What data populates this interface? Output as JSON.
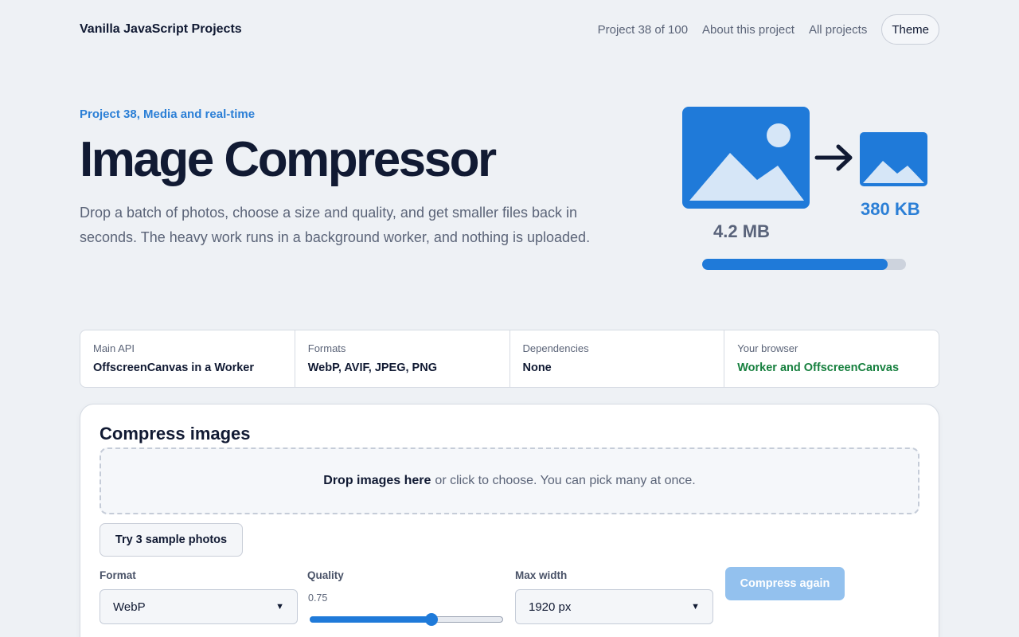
{
  "nav": {
    "brand": "Vanilla JavaScript Projects",
    "project_counter": "Project 38 of 100",
    "about_link": "About this project",
    "all_projects_link": "All projects",
    "theme_button": "Theme"
  },
  "hero": {
    "eyebrow": "Project 38, Media and real-time",
    "title": "Image Compressor",
    "lead": "Drop a batch of photos, choose a size and quality, and get smaller files back in seconds. The heavy work runs in a background worker, and nothing is uploaded.",
    "size_before": "4.2 MB",
    "size_after": "380 KB",
    "progress_fraction": 0.91
  },
  "facts": [
    {
      "label": "Main API",
      "value": "OffscreenCanvas in a Worker"
    },
    {
      "label": "Formats",
      "value": "WebP, AVIF, JPEG, PNG"
    },
    {
      "label": "Dependencies",
      "value": "None"
    },
    {
      "label": "Your browser",
      "value": "Worker and OffscreenCanvas"
    }
  ],
  "compress": {
    "title": "Compress images",
    "dropzone_strong": "Drop images here",
    "dropzone_text": "or click to choose. You can pick many at once.",
    "sample_button": "Try 3 sample photos",
    "format_label": "Format",
    "format_value": "WebP",
    "quality_label": "Quality",
    "quality_value": "0.75",
    "quality_fraction": 0.63,
    "max_width_label": "Max width",
    "max_width_value": "1920 px",
    "compress_button": "Compress again"
  },
  "colors": {
    "accent": "#1f7ad9",
    "success": "#17803f",
    "background": "#eef1f5"
  }
}
